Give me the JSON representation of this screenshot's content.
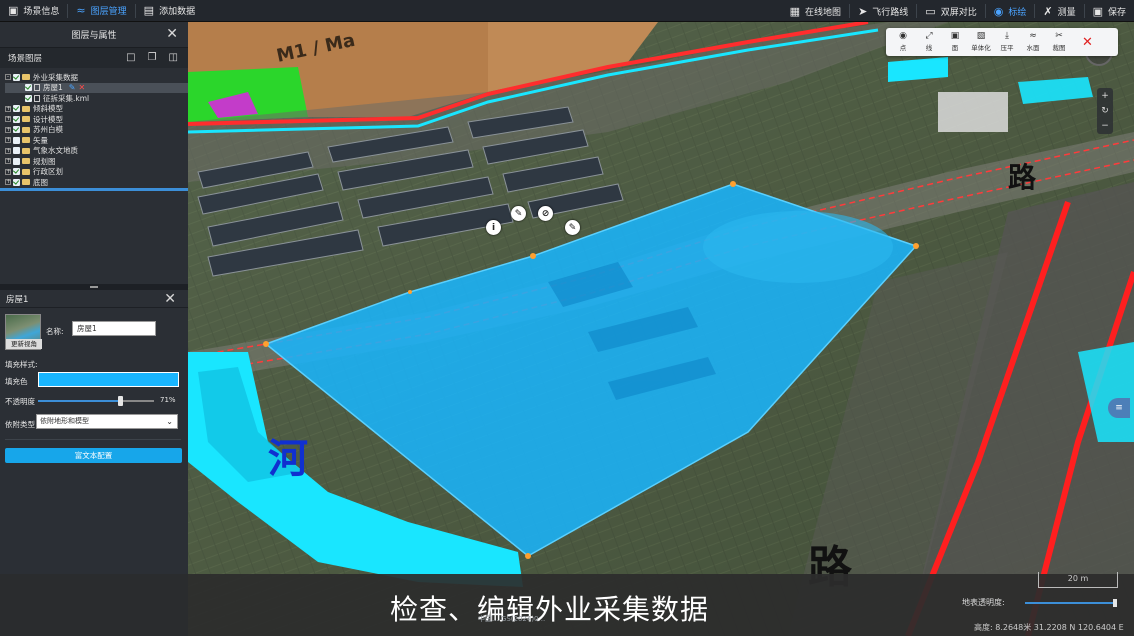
{
  "topbar": {
    "left": [
      {
        "icon": "scene-info-icon",
        "label": "场景信息",
        "active": false
      },
      {
        "icon": "layer-manage-icon",
        "label": "图层管理",
        "active": true
      },
      {
        "icon": "add-data-icon",
        "label": "添加数据",
        "active": false
      }
    ],
    "right": [
      {
        "icon": "online-map-icon",
        "label": "在线地图"
      },
      {
        "icon": "flight-route-icon",
        "label": "飞行路线"
      },
      {
        "icon": "dual-screen-icon",
        "label": "双屏对比"
      },
      {
        "icon": "mark-icon",
        "label": "标绘",
        "active": true
      },
      {
        "icon": "measure-icon",
        "label": "测量"
      },
      {
        "icon": "save-icon",
        "label": "保存"
      }
    ]
  },
  "panel": {
    "title": "图层与属性",
    "tree_title": "场景图层",
    "tree": [
      {
        "level": 0,
        "expand": "-",
        "checked": true,
        "type": "folder",
        "label": "外业采集数据"
      },
      {
        "level": 1,
        "expand": "",
        "checked": true,
        "type": "doc",
        "label": "房屋1",
        "selected": true
      },
      {
        "level": 1,
        "expand": "",
        "checked": true,
        "type": "line",
        "label": "征拆采集.kml"
      },
      {
        "level": 0,
        "expand": "+",
        "checked": true,
        "type": "folder",
        "label": "倾斜模型"
      },
      {
        "level": 0,
        "expand": "+",
        "checked": true,
        "type": "folder",
        "label": "设计模型"
      },
      {
        "level": 0,
        "expand": "+",
        "checked": true,
        "type": "folder",
        "label": "苏州白模"
      },
      {
        "level": 0,
        "expand": "+",
        "checked": false,
        "type": "folder",
        "label": "矢量"
      },
      {
        "level": 0,
        "expand": "+",
        "checked": false,
        "type": "folder",
        "label": "气象水文地质"
      },
      {
        "level": 0,
        "expand": "+",
        "checked": false,
        "type": "folder",
        "label": "规划图"
      },
      {
        "level": 0,
        "expand": "+",
        "checked": true,
        "type": "folder",
        "label": "行政区划"
      },
      {
        "level": 0,
        "expand": "+",
        "checked": true,
        "type": "folder",
        "label": "底图"
      }
    ]
  },
  "attr": {
    "title": "房屋1",
    "thumb_label": "更新视角",
    "name_label": "名称:",
    "name_value": "房屋1",
    "fill_style_label": "填充样式:",
    "fill_color_label": "填充色",
    "fill_color": "#19b6ff",
    "opacity_label": "不透明度",
    "opacity_value": "71%",
    "opacity": 0.71,
    "attach_label": "依附类型",
    "attach_value": "依附地形和模型",
    "rich_text_button": "富文本配置"
  },
  "draw_toolbar": [
    {
      "icon": "point-icon",
      "label": "点"
    },
    {
      "icon": "line-icon",
      "label": "线"
    },
    {
      "icon": "polygon-icon",
      "label": "面"
    },
    {
      "icon": "monomer-icon",
      "label": "单体化"
    },
    {
      "icon": "flatten-icon",
      "label": "压平"
    },
    {
      "icon": "water-icon",
      "label": "水面"
    },
    {
      "icon": "clip-icon",
      "label": "裁图"
    }
  ],
  "map": {
    "caption": "检查、编辑外业采集数据",
    "scale": "20 m",
    "copyright": "中国... GS(2024)0...",
    "terrain_transparency_label": "地表透明度:",
    "status": "高度: 8.2648米 31.2208 N 120.6404 E",
    "label_land": "M1 / Ma",
    "label_river": "河",
    "label_road1": "路",
    "label_road2": "路",
    "polygon_color": "#19b6ff"
  }
}
